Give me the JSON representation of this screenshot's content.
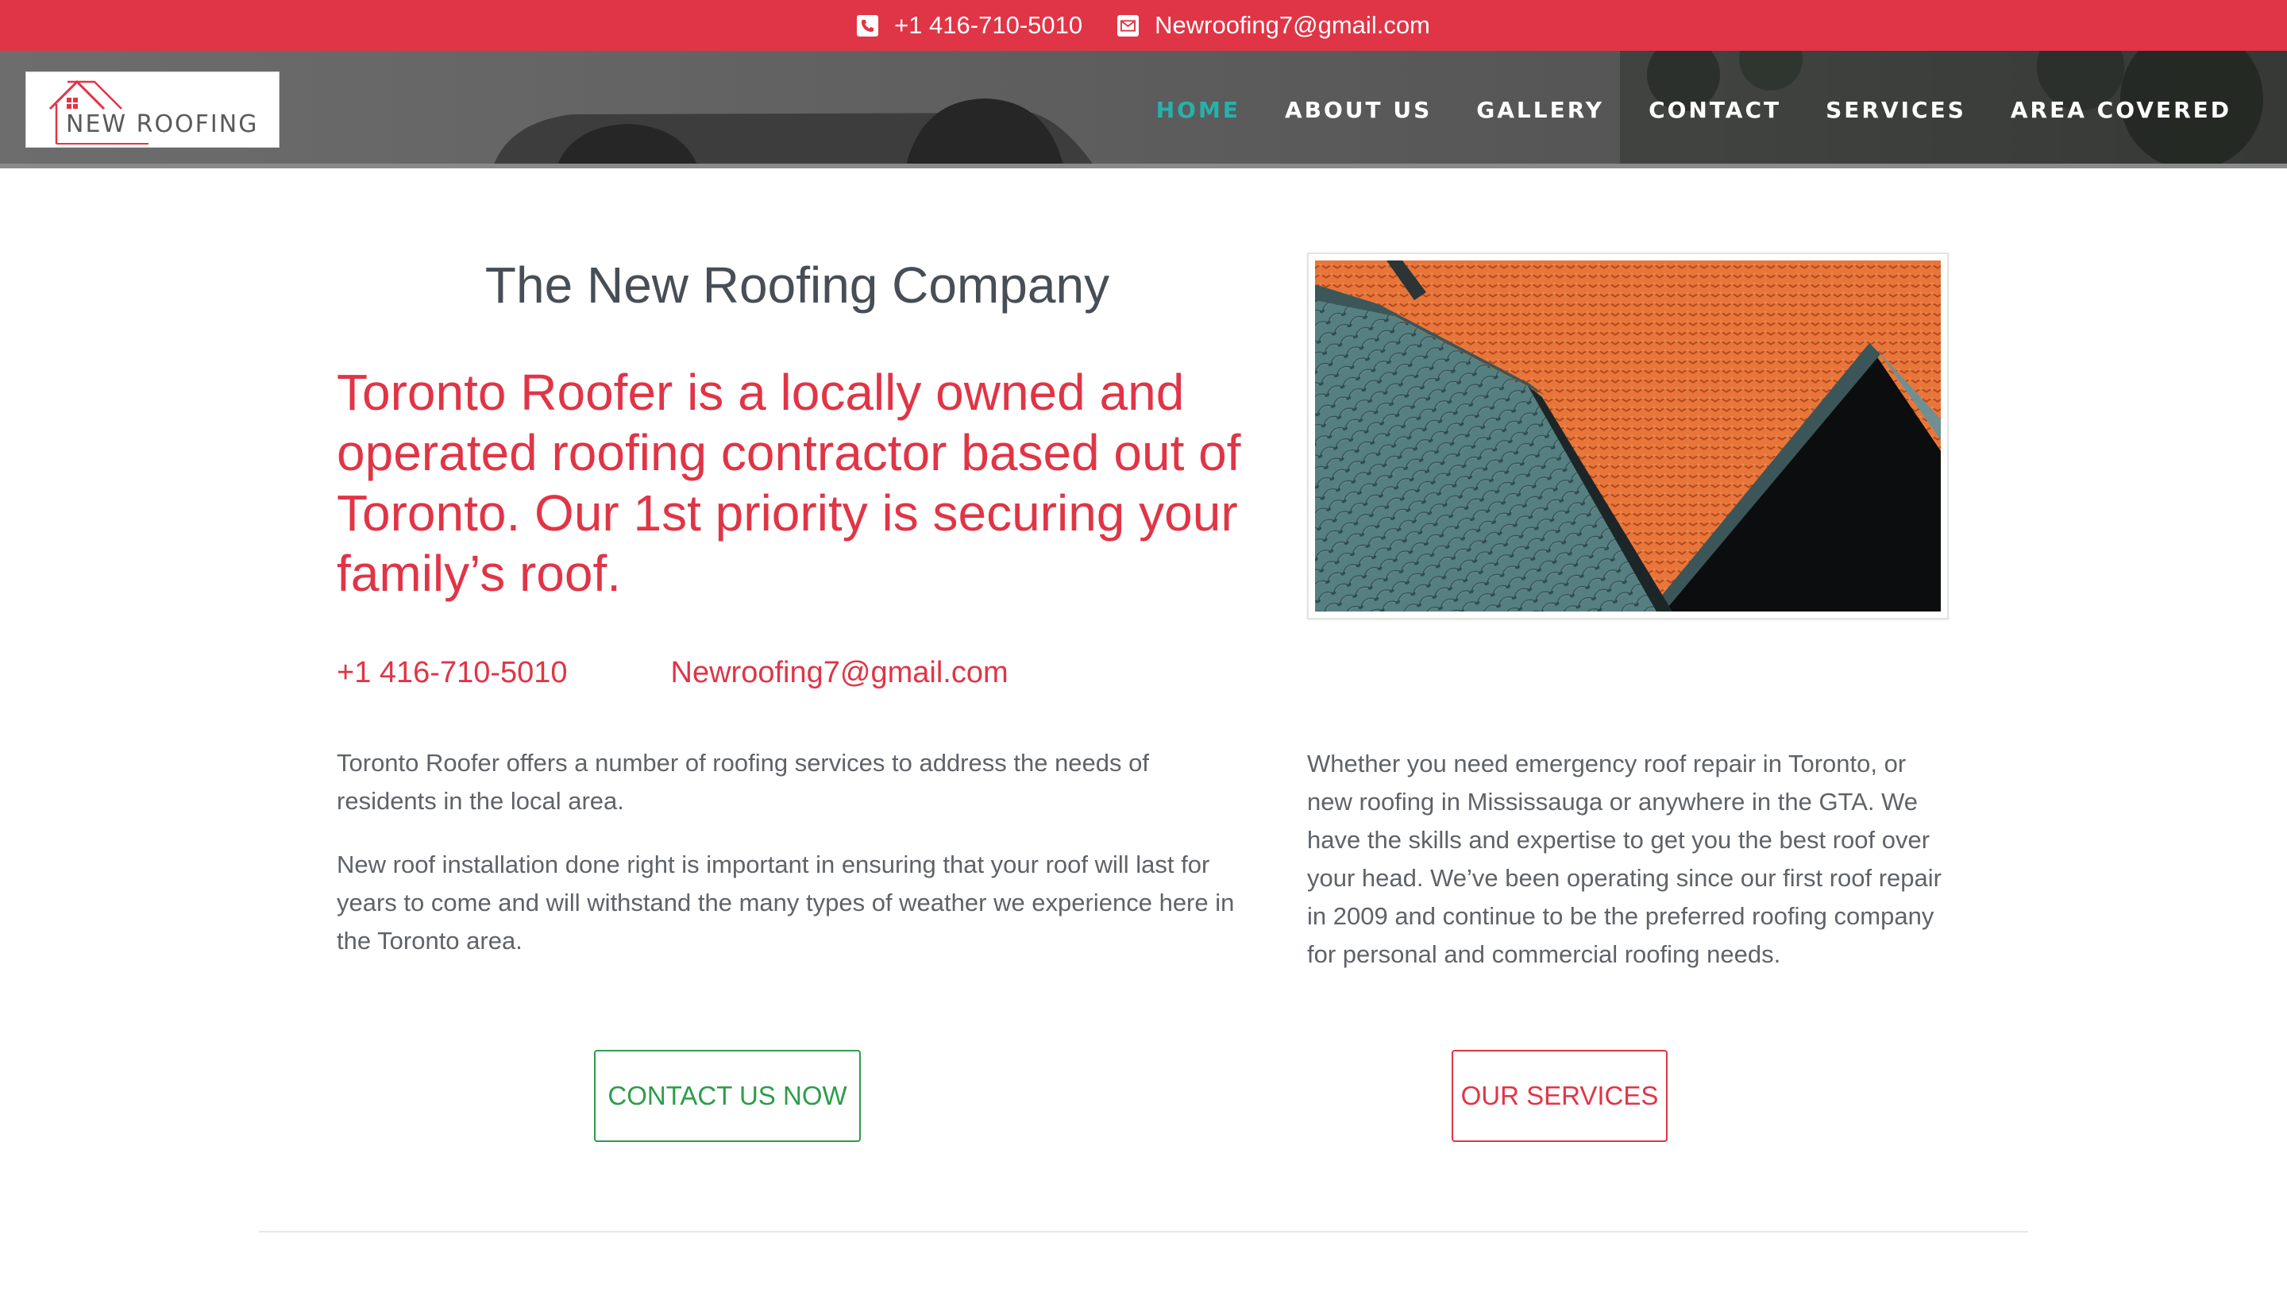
{
  "topbar": {
    "phone": "+1 416-710-5010",
    "phone_icon": "phone-icon",
    "email": "Newroofing7@gmail.com",
    "email_icon": "envelope-icon",
    "bg_color": "#e03546"
  },
  "header": {
    "logo_text": "NEW ROOFING",
    "nav": [
      {
        "label": "HOME",
        "active": true
      },
      {
        "label": "ABOUT US"
      },
      {
        "label": "GALLERY"
      },
      {
        "label": "CONTACT"
      },
      {
        "label": "SERVICES"
      },
      {
        "label": "AREA COVERED"
      }
    ],
    "active_color": "#27b1ab"
  },
  "main": {
    "title": "The New Roofing Company",
    "lead": "Toronto Roofer is a locally owned and operated roofing contractor based out of Toronto. Our 1st priority is securing your family’s roof.",
    "phone": "+1 416-710-5010",
    "email": "Newroofing7@gmail.com",
    "paragraph_1": "Toronto Roofer offers a number of roofing services to address the needs of residents in the local area.",
    "paragraph_2": "New roof installation done right is important in ensuring that your roof will last for years to come and will withstand the many types of weather we experience here in the Toronto area.",
    "paragraph_3": "Whether you need emergency roof repair in Toronto, or new roofing in Mississauga or anywhere in the GTA. We have the skills and expertise to get you the best roof over your head. We’ve been operating since our first roof repair in 2009 and continue to be the preferred roofing company for personal and commercial roofing needs.",
    "contact_button": "CONTACT US NOW",
    "services_button": "OUR SERVICES",
    "accent_red": "#e03546",
    "accent_green": "#2e9c4a"
  }
}
